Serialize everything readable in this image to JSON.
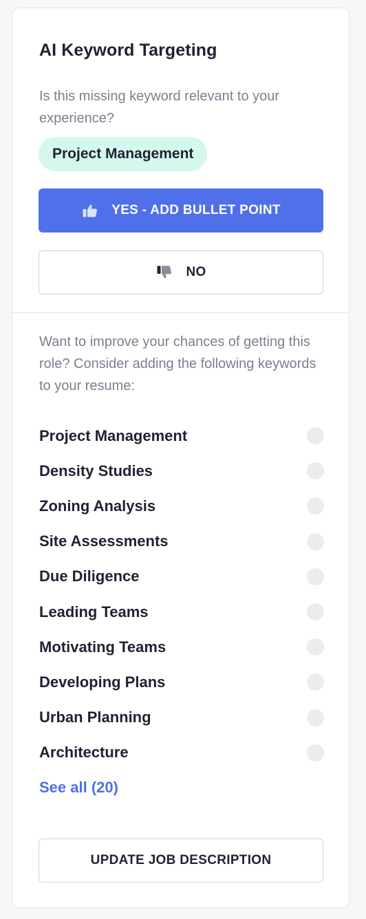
{
  "panel": {
    "title": "AI Keyword Targeting",
    "question": "Is this missing keyword relevant to your experience?",
    "keyword_chip": "Project Management",
    "yes_label": "YES - ADD BULLET POINT",
    "no_label": "NO",
    "improve_text": "Want to improve your chances of getting this role? Consider adding the following keywords to your resume:",
    "keywords": [
      {
        "label": "Project Management"
      },
      {
        "label": "Density Studies"
      },
      {
        "label": "Zoning Analysis"
      },
      {
        "label": "Site Assessments"
      },
      {
        "label": "Due Diligence"
      },
      {
        "label": "Leading Teams"
      },
      {
        "label": "Motivating Teams"
      },
      {
        "label": "Developing Plans"
      },
      {
        "label": "Urban Planning"
      },
      {
        "label": "Architecture"
      }
    ],
    "see_all_label": "See all (20)",
    "update_label": "UPDATE JOB DESCRIPTION"
  },
  "icons": {
    "yes": "thumbs-up-icon",
    "no": "thumbs-down-icon"
  },
  "colors": {
    "accent": "#4f70e8",
    "chip_bg": "#d4f7ee",
    "muted_text": "#7a7f8e",
    "dot": "#ececee"
  }
}
